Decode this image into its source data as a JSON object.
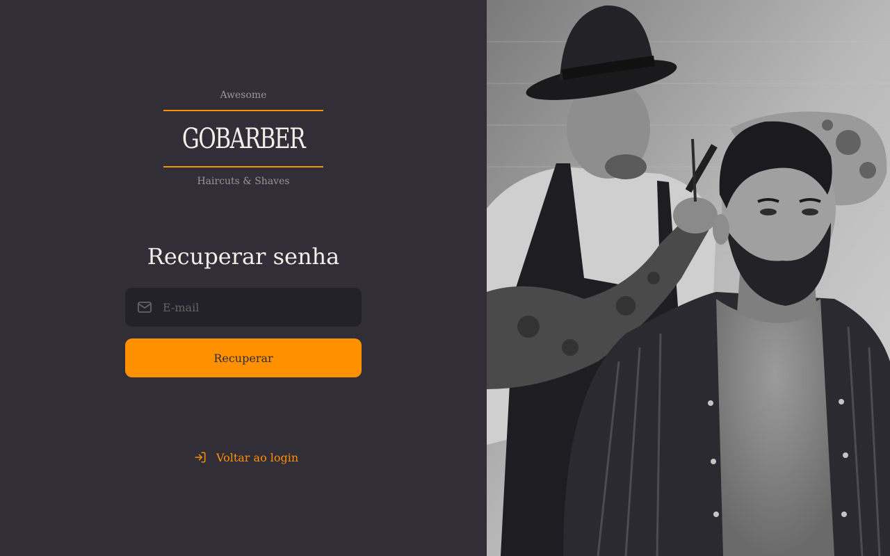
{
  "logo": {
    "top_text": "Awesome",
    "brand": "GoBarber",
    "bottom_text": "Haircuts & Shaves"
  },
  "form": {
    "title": "Recuperar senha",
    "email_placeholder": "E-mail",
    "email_value": "",
    "submit_label": "Recuperar"
  },
  "back_link": {
    "label": "Voltar ao login",
    "icon": "log-in-icon"
  },
  "icons": {
    "email": "mail-icon"
  },
  "colors": {
    "background": "#312e38",
    "input_background": "#232129",
    "accent": "#ff9000",
    "text": "#f4ede8",
    "muted": "#999591",
    "placeholder": "#666360"
  }
}
